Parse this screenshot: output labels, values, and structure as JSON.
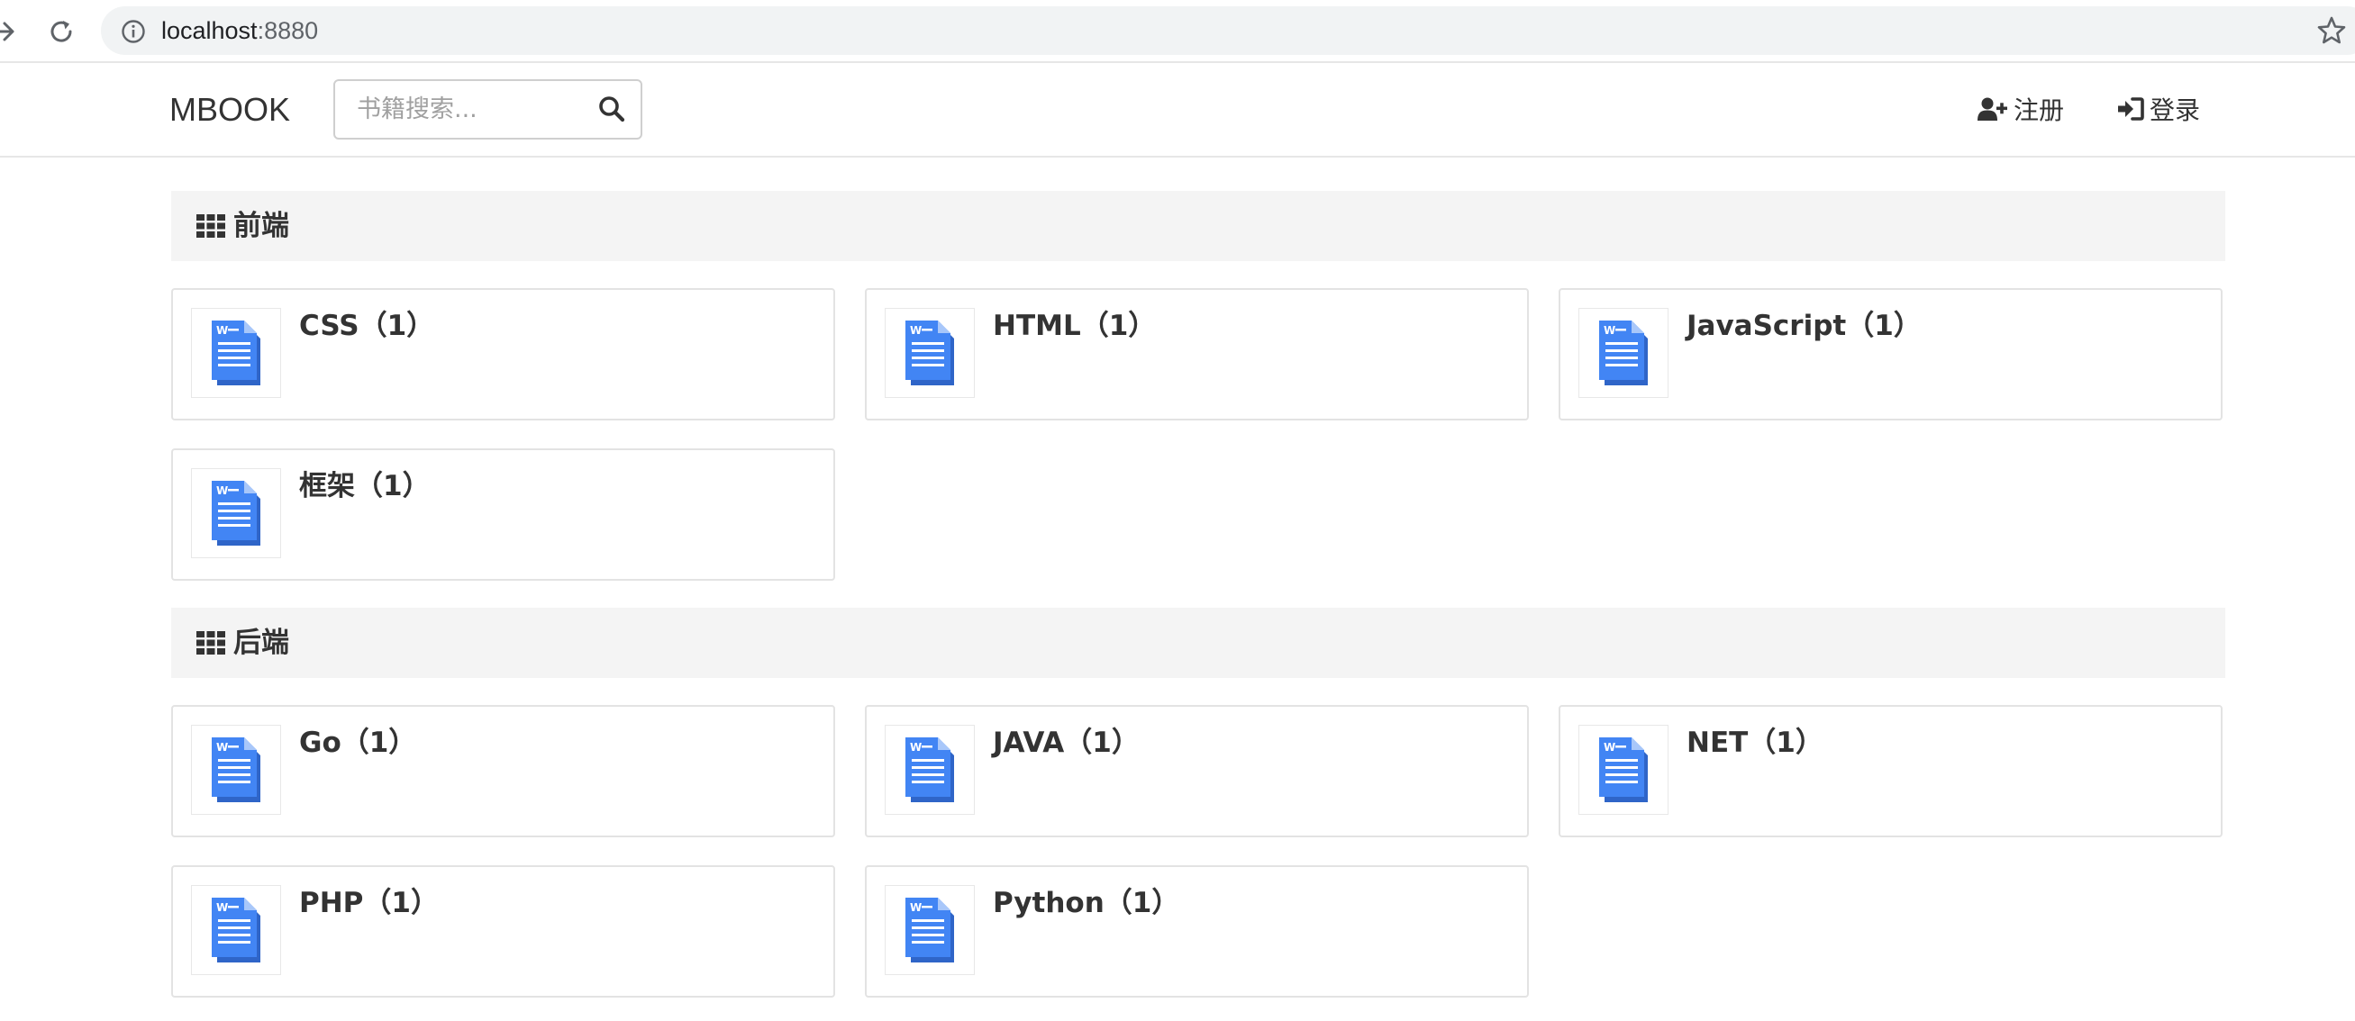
{
  "browser": {
    "url_host": "localhost",
    "url_port": ":8880"
  },
  "navbar": {
    "brand": "MBOOK",
    "search_placeholder": "书籍搜索...",
    "register_label": "注册",
    "login_label": "登录"
  },
  "sections": [
    {
      "title": "前端",
      "books": [
        {
          "label": "CSS（1）"
        },
        {
          "label": "HTML（1）"
        },
        {
          "label": "JavaScript（1）"
        },
        {
          "label": "框架（1）"
        }
      ]
    },
    {
      "title": "后端",
      "books": [
        {
          "label": "Go（1）"
        },
        {
          "label": "JAVA（1）"
        },
        {
          "label": "NET（1）"
        },
        {
          "label": "PHP（1）"
        },
        {
          "label": "Python（1）"
        }
      ]
    }
  ],
  "colors": {
    "doc_icon": "#3b7ddd",
    "section_bg": "#f4f4f4",
    "text": "#333333"
  }
}
